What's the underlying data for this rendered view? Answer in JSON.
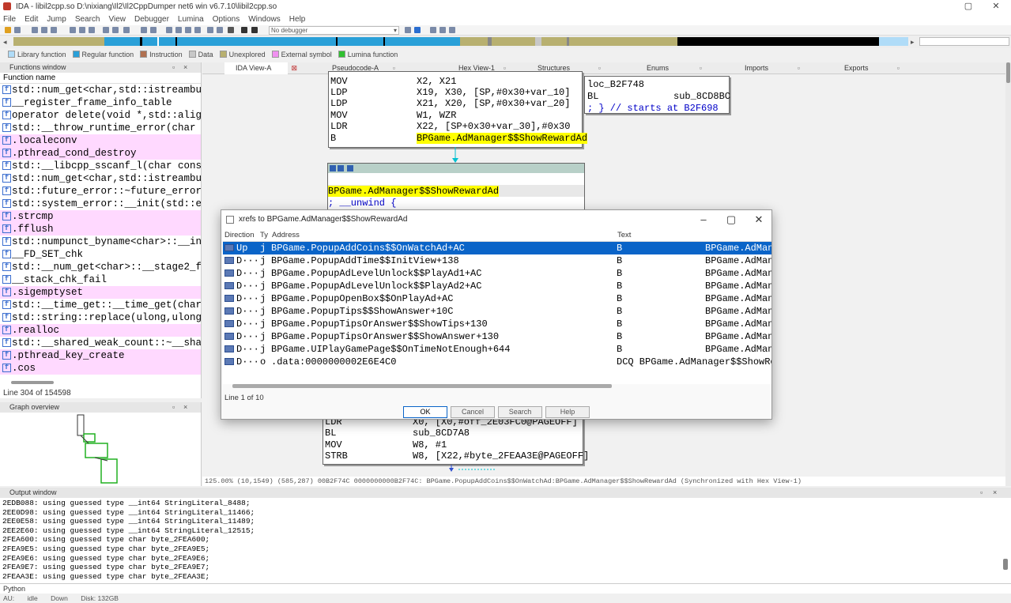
{
  "window": {
    "title": "IDA - libil2cpp.so D:\\nixiang\\Il2\\Il2CppDumper net6 win v6.7.10\\libil2cpp.so",
    "minimize": "–",
    "restore": "▢",
    "close": "✕"
  },
  "menu": [
    "File",
    "Edit",
    "Jump",
    "Search",
    "View",
    "Debugger",
    "Lumina",
    "Options",
    "Windows",
    "Help"
  ],
  "toolbar": {
    "debugger_select": "No debugger"
  },
  "legend": [
    {
      "label": "Library function",
      "color": "#b0dcf8"
    },
    {
      "label": "Regular function",
      "color": "#2aa0d8"
    },
    {
      "label": "Instruction",
      "color": "#b07050"
    },
    {
      "label": "Data",
      "color": "#c8c8c8"
    },
    {
      "label": "Unexplored",
      "color": "#b8b070"
    },
    {
      "label": "External symbol",
      "color": "#f090f0"
    },
    {
      "label": "Lumina function",
      "color": "#30c030"
    }
  ],
  "functions_window": {
    "title": "Functions window",
    "column": "Function name",
    "items": [
      {
        "name": "std::num_get<char,std::istreambu",
        "pink": false
      },
      {
        "name": "__register_frame_info_table",
        "pink": false
      },
      {
        "name": "operator delete(void *,std::alig",
        "pink": false
      },
      {
        "name": "std::__throw_runtime_error(char",
        "pink": false
      },
      {
        "name": ".localeconv",
        "pink": true
      },
      {
        "name": ".pthread_cond_destroy",
        "pink": true
      },
      {
        "name": "std::__libcpp_sscanf_l(char cons",
        "pink": false
      },
      {
        "name": "std::num_get<char,std::istreambu",
        "pink": false
      },
      {
        "name": "std::future_error::~future_error",
        "pink": false
      },
      {
        "name": "std::system_error::__init(std::e",
        "pink": false
      },
      {
        "name": ".strcmp",
        "pink": true
      },
      {
        "name": ".fflush",
        "pink": true
      },
      {
        "name": "std::numpunct_byname<char>::__in",
        "pink": false
      },
      {
        "name": "__FD_SET_chk",
        "pink": false
      },
      {
        "name": "std::__num_get<char>::__stage2_f",
        "pink": false
      },
      {
        "name": "__stack_chk_fail",
        "pink": false
      },
      {
        "name": ".sigemptyset",
        "pink": true
      },
      {
        "name": "std::__time_get::__time_get(char",
        "pink": false
      },
      {
        "name": "std::string::replace(ulong,ulong",
        "pink": false
      },
      {
        "name": ".realloc",
        "pink": true
      },
      {
        "name": "std::__shared_weak_count::~__sha",
        "pink": false
      },
      {
        "name": ".pthread_key_create",
        "pink": true
      },
      {
        "name": ".cos",
        "pink": true
      }
    ],
    "status": "Line 304 of 154598"
  },
  "graph_overview": {
    "title": "Graph overview"
  },
  "tabs": [
    {
      "label": "IDA View-A",
      "active": true
    },
    {
      "label": "Pseudocode-A",
      "active": false
    },
    {
      "label": "Hex View-1",
      "active": false
    },
    {
      "label": "Structures",
      "active": false
    },
    {
      "label": "Enums",
      "active": false
    },
    {
      "label": "Imports",
      "active": false
    },
    {
      "label": "Exports",
      "active": false
    }
  ],
  "disasm": {
    "block1": [
      {
        "op": "MOV",
        "args": "X2, X21"
      },
      {
        "op": "LDP",
        "args": "X19, X30, [SP,#0x30+var_10]"
      },
      {
        "op": "LDP",
        "args": "X21, X20, [SP,#0x30+var_20]"
      },
      {
        "op": "MOV",
        "args": "W1, WZR"
      },
      {
        "op": "LDR",
        "args": "X22, [SP+0x30+var_30],#0x30"
      },
      {
        "op": "B",
        "args": "BPGame.AdManager$$ShowRewardAd"
      }
    ],
    "block2": {
      "label": "loc_B2F748",
      "op": "BL",
      "args": "sub_8CD8BC",
      "comment": "; } // starts at B2F698"
    },
    "block3": {
      "func": "BPGame.AdManager$$ShowRewardAd",
      "unwind": "; __unwind {"
    },
    "block4": [
      {
        "op": "LDR",
        "args": "X0, [X0,#off_2E03FC0@PAGEOFF]"
      },
      {
        "op": "BL",
        "args": "sub_8CD7A8"
      },
      {
        "op": "MOV",
        "args": "W8, #1"
      },
      {
        "op": "STRB",
        "args": "W8, [X22,#byte_2FEAA3E@PAGEOFF]"
      }
    ],
    "status": "125.00% (10,1549) (585,287) 00B2F74C 0000000000B2F74C: BPGame.PopupAddCoins$$OnWatchAd:BPGame.AdManager$$ShowRewardAd (Synchronized with Hex View-1)"
  },
  "xrefs_dialog": {
    "title": "xrefs to BPGame.AdManager$$ShowRewardAd",
    "columns": {
      "direction": "Direction",
      "type": "Ty",
      "address": "Address",
      "text": "Text"
    },
    "rows": [
      {
        "dir": "Up",
        "type": "j",
        "address": "BPGame.PopupAddCoins$$OnWatchAd+AC",
        "text": "B",
        "target": "BPGame.AdMana",
        "selected": true
      },
      {
        "dir": "D···",
        "type": "j",
        "address": "BPGame.PopupAddTime$$InitView+138",
        "text": "B",
        "target": "BPGame.AdMana",
        "selected": false
      },
      {
        "dir": "D···",
        "type": "j",
        "address": "BPGame.PopupAdLevelUnlock$$PlayAd1+AC",
        "text": "B",
        "target": "BPGame.AdMana",
        "selected": false
      },
      {
        "dir": "D···",
        "type": "j",
        "address": "BPGame.PopupAdLevelUnlock$$PlayAd2+AC",
        "text": "B",
        "target": "BPGame.AdMana",
        "selected": false
      },
      {
        "dir": "D···",
        "type": "j",
        "address": "BPGame.PopupOpenBox$$OnPlayAd+AC",
        "text": "B",
        "target": "BPGame.AdMana",
        "selected": false
      },
      {
        "dir": "D···",
        "type": "j",
        "address": "BPGame.PopupTips$$ShowAnswer+10C",
        "text": "B",
        "target": "BPGame.AdMana",
        "selected": false
      },
      {
        "dir": "D···",
        "type": "j",
        "address": "BPGame.PopupTipsOrAnswer$$ShowTips+130",
        "text": "B",
        "target": "BPGame.AdMana",
        "selected": false
      },
      {
        "dir": "D···",
        "type": "j",
        "address": "BPGame.PopupTipsOrAnswer$$ShowAnswer+130",
        "text": "B",
        "target": "BPGame.AdMana",
        "selected": false
      },
      {
        "dir": "D···",
        "type": "j",
        "address": "BPGame.UIPlayGamePage$$OnTimeNotEnough+644",
        "text": "B",
        "target": "BPGame.AdMana",
        "selected": false
      },
      {
        "dir": "D···",
        "type": "o",
        "address": ".data:0000000002E6E4C0",
        "text": "DCQ BPGame.AdManager$$ShowRe",
        "target": "",
        "selected": false
      }
    ],
    "status": "Line 1 of 10",
    "buttons": {
      "ok": "OK",
      "cancel": "Cancel",
      "search": "Search",
      "help": "Help"
    }
  },
  "output": {
    "title": "Output window",
    "lines": [
      "2EDB088: using guessed type __int64 StringLiteral_8488;",
      "2EE0D98: using guessed type __int64 StringLiteral_11466;",
      "2EE0E58: using guessed type __int64 StringLiteral_11489;",
      "2EE2E60: using guessed type __int64 StringLiteral_12515;",
      "2FEA600: using guessed type char byte_2FEA600;",
      "2FEA9E5: using guessed type char byte_2FEA9E5;",
      "2FEA9E6: using guessed type char byte_2FEA9E6;",
      "2FEA9E7: using guessed type char byte_2FEA9E7;",
      "2FEAA3E: using guessed type char byte_2FEAA3E;"
    ],
    "python_label": "Python"
  },
  "statusbar": {
    "au": "AU:",
    "state": "idle",
    "direction": "Down",
    "disk": "Disk: 132GB"
  }
}
